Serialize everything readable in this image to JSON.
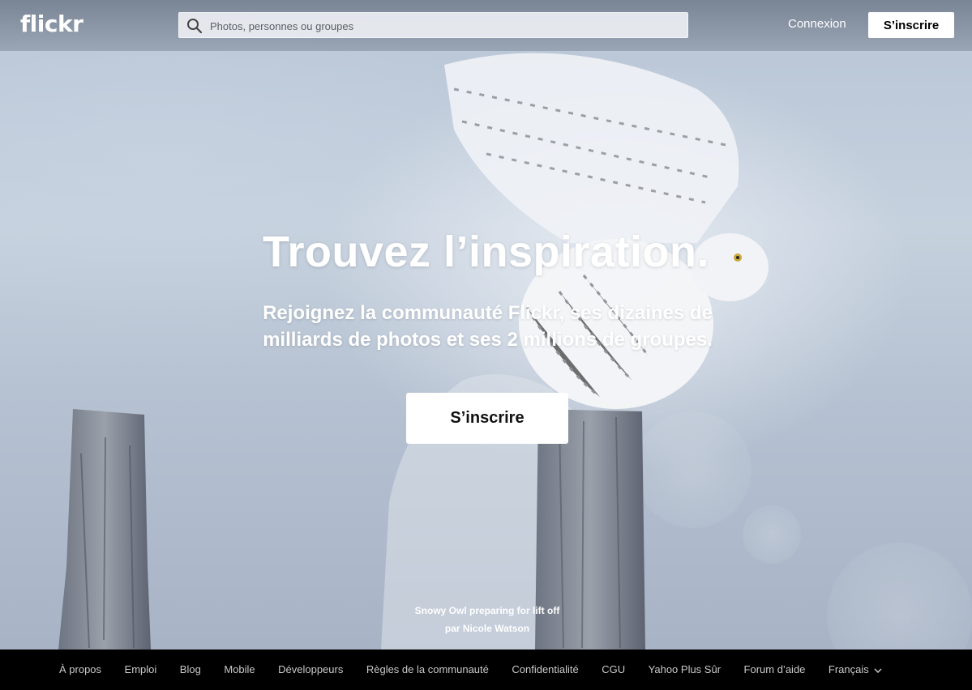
{
  "header": {
    "logo": "flickr",
    "search_placeholder": "Photos, personnes ou groupes",
    "login_label": "Connexion",
    "signup_label": "S’inscrire"
  },
  "hero": {
    "headline": "Trouvez l’inspiration.",
    "subline": "Rejoignez la communauté Flickr, ses dizaines de milliards de photos et ses 2 millions de groupes.",
    "signup_label": "S’inscrire",
    "photo_title": "Snowy Owl preparing for lift off",
    "photo_author": "par Nicole Watson"
  },
  "footer": {
    "links": [
      "À propos",
      "Emploi",
      "Blog",
      "Mobile",
      "Développeurs",
      "Règles de la communauté",
      "Confidentialité",
      "CGU",
      "Yahoo Plus Sûr",
      "Forum d’aide",
      "Français"
    ]
  },
  "colors": {
    "signup_bg": "#ffffff",
    "footer_bg": "#000000",
    "footer_text": "#c9c9c9"
  }
}
